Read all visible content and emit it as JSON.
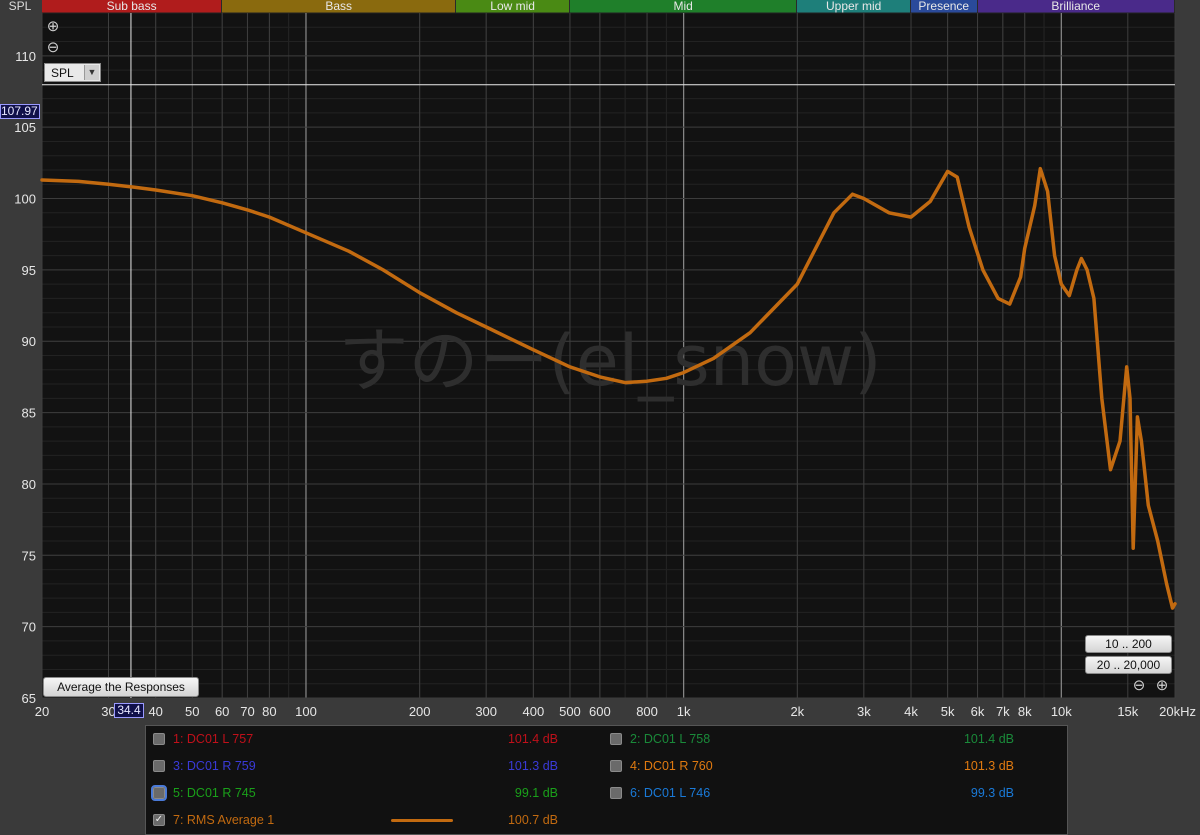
{
  "corner_label": "SPL",
  "bands": [
    {
      "label": "Sub bass",
      "from": 20,
      "to": 60,
      "color": "#b01c1c"
    },
    {
      "label": "Bass",
      "from": 60,
      "to": 250,
      "color": "#8a6a0e"
    },
    {
      "label": "Low mid",
      "from": 250,
      "to": 500,
      "color": "#4a8a14"
    },
    {
      "label": "Mid",
      "from": 500,
      "to": 2000,
      "color": "#1f7f2a"
    },
    {
      "label": "Upper mid",
      "from": 2000,
      "to": 4000,
      "color": "#1e7f7a"
    },
    {
      "label": "Presence",
      "from": 4000,
      "to": 6000,
      "color": "#2a4a9a"
    },
    {
      "label": "Brilliance",
      "from": 6000,
      "to": 20000,
      "color": "#4a2a8a"
    }
  ],
  "zoom": {
    "in_symbol": "⊕",
    "out_symbol": "⊖"
  },
  "y_select": {
    "value": "SPL",
    "arrow": "▼"
  },
  "cursor": {
    "y_value": "107.97",
    "x_value": "34.4",
    "y_db": 107.97,
    "x_hz": 34.4
  },
  "buttons": {
    "average": "Average the Responses",
    "range_low": "10 .. 200",
    "range_full": "20 .. 20,000"
  },
  "watermark": "すのー(el_snow)",
  "chart_data": {
    "type": "line",
    "x_scale": "log",
    "xlim": [
      20,
      20000
    ],
    "ylim": [
      65,
      113
    ],
    "grid": true,
    "x_ticks": [
      {
        "v": 20,
        "label": "20"
      },
      {
        "v": 30,
        "label": "30"
      },
      {
        "v": 40,
        "label": "40"
      },
      {
        "v": 50,
        "label": "50"
      },
      {
        "v": 60,
        "label": "60"
      },
      {
        "v": 70,
        "label": "70"
      },
      {
        "v": 80,
        "label": "80"
      },
      {
        "v": 100,
        "label": "100"
      },
      {
        "v": 200,
        "label": "200"
      },
      {
        "v": 300,
        "label": "300"
      },
      {
        "v": 400,
        "label": "400"
      },
      {
        "v": 500,
        "label": "500"
      },
      {
        "v": 600,
        "label": "600"
      },
      {
        "v": 800,
        "label": "800"
      },
      {
        "v": 1000,
        "label": "1k"
      },
      {
        "v": 2000,
        "label": "2k"
      },
      {
        "v": 3000,
        "label": "3k"
      },
      {
        "v": 4000,
        "label": "4k"
      },
      {
        "v": 5000,
        "label": "5k"
      },
      {
        "v": 6000,
        "label": "6k"
      },
      {
        "v": 7000,
        "label": "7k"
      },
      {
        "v": 8000,
        "label": "8k"
      },
      {
        "v": 10000,
        "label": "10k"
      },
      {
        "v": 15000,
        "label": "15k"
      },
      {
        "v": 20000,
        "label": "20kHz"
      }
    ],
    "y_ticks": [
      65,
      70,
      75,
      80,
      85,
      90,
      95,
      100,
      105,
      110
    ],
    "series": [
      {
        "name": "7: RMS Average 1",
        "color": "#c26a10",
        "points": [
          [
            20,
            101.3
          ],
          [
            25,
            101.2
          ],
          [
            30,
            101.0
          ],
          [
            35,
            100.8
          ],
          [
            40,
            100.6
          ],
          [
            50,
            100.2
          ],
          [
            60,
            99.7
          ],
          [
            70,
            99.2
          ],
          [
            80,
            98.7
          ],
          [
            100,
            97.6
          ],
          [
            130,
            96.3
          ],
          [
            160,
            95.0
          ],
          [
            200,
            93.4
          ],
          [
            250,
            92.0
          ],
          [
            300,
            91.0
          ],
          [
            400,
            89.4
          ],
          [
            500,
            88.2
          ],
          [
            600,
            87.5
          ],
          [
            700,
            87.1
          ],
          [
            800,
            87.2
          ],
          [
            900,
            87.4
          ],
          [
            1000,
            87.8
          ],
          [
            1200,
            88.8
          ],
          [
            1500,
            90.6
          ],
          [
            2000,
            94.0
          ],
          [
            2500,
            99.0
          ],
          [
            2800,
            100.3
          ],
          [
            3000,
            100.0
          ],
          [
            3500,
            99.0
          ],
          [
            4000,
            98.7
          ],
          [
            4500,
            99.8
          ],
          [
            5000,
            101.9
          ],
          [
            5300,
            101.5
          ],
          [
            5700,
            98.0
          ],
          [
            6200,
            95.0
          ],
          [
            6800,
            93.0
          ],
          [
            7300,
            92.6
          ],
          [
            7800,
            94.5
          ],
          [
            8000,
            96.5
          ],
          [
            8500,
            99.5
          ],
          [
            8800,
            102.1
          ],
          [
            9200,
            100.5
          ],
          [
            9600,
            96.0
          ],
          [
            10000,
            94.0
          ],
          [
            10500,
            93.2
          ],
          [
            11000,
            95.0
          ],
          [
            11300,
            95.8
          ],
          [
            11700,
            95.0
          ],
          [
            12200,
            93.0
          ],
          [
            12800,
            86.0
          ],
          [
            13500,
            81.0
          ],
          [
            14300,
            83.0
          ],
          [
            14900,
            88.2
          ],
          [
            15200,
            86.0
          ],
          [
            15500,
            75.5
          ],
          [
            15900,
            84.7
          ],
          [
            16300,
            83.0
          ],
          [
            17000,
            78.5
          ],
          [
            18000,
            76.0
          ],
          [
            19000,
            73.0
          ],
          [
            19700,
            71.3
          ],
          [
            20000,
            71.6
          ]
        ]
      }
    ]
  },
  "legend": [
    {
      "checked": false,
      "focused": false,
      "name": "1: DC01 L 757",
      "value": "101.4 dB",
      "color": "#c0101a",
      "check": ""
    },
    {
      "checked": false,
      "focused": false,
      "name": "2: DC01 L 758",
      "value": "101.4 dB",
      "color": "#1a8a3a",
      "check": ""
    },
    {
      "checked": false,
      "focused": false,
      "name": "3: DC01 R 759",
      "value": "101.3 dB",
      "color": "#3a3ad8",
      "check": ""
    },
    {
      "checked": false,
      "focused": false,
      "name": "4: DC01 R 760",
      "value": "101.3 dB",
      "color": "#e07a10",
      "check": ""
    },
    {
      "checked": false,
      "focused": true,
      "name": "5: DC01 R 745",
      "value": "99.1 dB",
      "color": "#1aa01a",
      "check": ""
    },
    {
      "checked": false,
      "focused": false,
      "name": "6: DC01 L 746",
      "value": "99.3 dB",
      "color": "#1a7ad8",
      "check": ""
    },
    {
      "checked": true,
      "focused": false,
      "name": "7: RMS Average 1",
      "value": "100.7 dB",
      "color": "#c26a10",
      "check": "✓"
    }
  ]
}
